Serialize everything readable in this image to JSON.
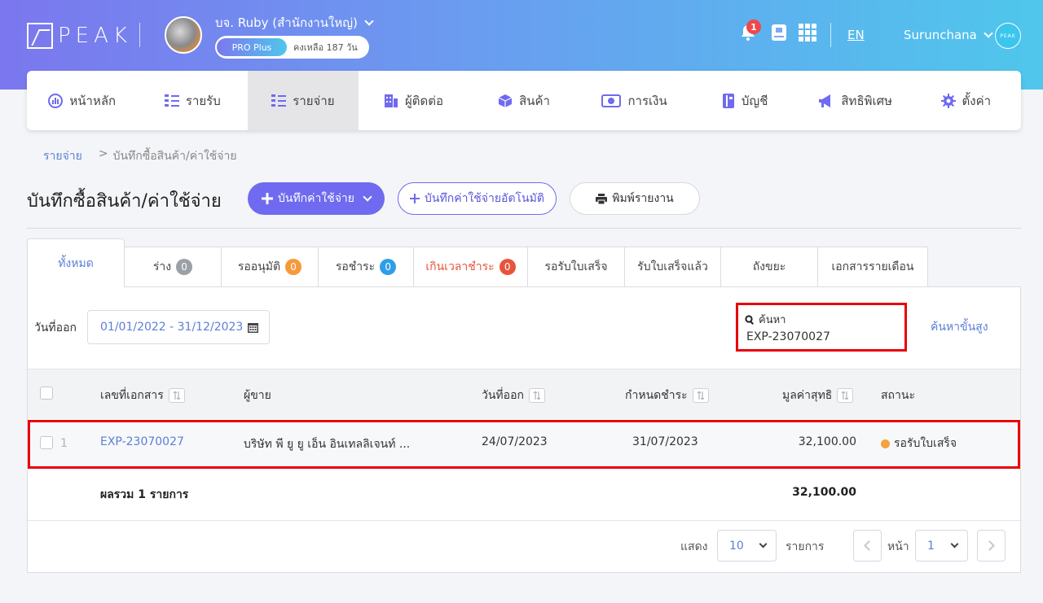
{
  "header": {
    "logo_text": "PEAK",
    "company_name": "บจ. Ruby (สำนักงานใหญ่)",
    "plan_badge": "PRO Plus",
    "plan_remaining": "คงเหลือ 187 วัน",
    "notification_count": "1",
    "language": "EN",
    "user_name": "Surunchana",
    "user_avatar_text": "PEAK"
  },
  "nav": {
    "items": [
      {
        "label": "หน้าหลัก",
        "icon": "dashboard-icon"
      },
      {
        "label": "รายรับ",
        "icon": "income-icon"
      },
      {
        "label": "รายจ่าย",
        "icon": "expense-icon",
        "active": true
      },
      {
        "label": "ผู้ติดต่อ",
        "icon": "contacts-icon"
      },
      {
        "label": "สินค้า",
        "icon": "box-icon"
      },
      {
        "label": "การเงิน",
        "icon": "money-icon"
      },
      {
        "label": "บัญชี",
        "icon": "ledger-icon"
      },
      {
        "label": "สิทธิพิเศษ",
        "icon": "megaphone-icon"
      },
      {
        "label": "ตั้งค่า",
        "icon": "gear-icon"
      }
    ]
  },
  "breadcrumb": {
    "root": "รายจ่าย",
    "separator": ">",
    "current": "บันทึกซื้อสินค้า/ค่าใช้จ่าย"
  },
  "page": {
    "title": "บันทึกซื้อสินค้า/ค่าใช้จ่าย",
    "btn_add": "บันทึกค่าใช้จ่าย",
    "btn_auto": "บันทึกค่าใช้จ่ายอัตโนมัติ",
    "btn_print": "พิมพ์รายงาน"
  },
  "tabs": [
    {
      "label": "ทั้งหมด",
      "count": ""
    },
    {
      "label": "ร่าง",
      "count": "0",
      "color": "#9aa0a6"
    },
    {
      "label": "รออนุมัติ",
      "count": "0",
      "color": "#f59a3a"
    },
    {
      "label": "รอชำระ",
      "count": "0",
      "color": "#2f9ee8"
    },
    {
      "label": "เกินเวลาชำระ",
      "count": "0",
      "color": "#e8543b"
    },
    {
      "label": "รอรับใบเสร็จ",
      "count": ""
    },
    {
      "label": "รับใบเสร็จแล้ว",
      "count": ""
    },
    {
      "label": "ถังขยะ",
      "count": ""
    },
    {
      "label": "เอกสารรายเดือน",
      "count": ""
    }
  ],
  "filters": {
    "date_label": "วันที่ออก",
    "date_range": "01/01/2022 - 31/12/2023",
    "search_label": "ค้นหา",
    "search_value": "EXP-23070027",
    "advanced_search": "ค้นหาขั้นสูง"
  },
  "table": {
    "columns": [
      "เลขที่เอกสาร",
      "ผู้ขาย",
      "วันที่ออก",
      "กำหนดชำระ",
      "มูลค่าสุทธิ",
      "สถานะ"
    ],
    "rows": [
      {
        "index": "1",
        "doc_no": "EXP-23070027",
        "vendor": "บริษัท พี ยู ยู เอ็น อินเทลลิเจนท์ ...",
        "issue_date": "24/07/2023",
        "due_date": "31/07/2023",
        "net_amount": "32,100.00",
        "status": "รอรับใบเสร็จ",
        "status_color": "#f5a23d"
      }
    ],
    "total_label": "ผลรวม 1 รายการ",
    "total_value": "32,100.00"
  },
  "pagination": {
    "show_label": "แสดง",
    "page_size": "10",
    "items_label": "รายการ",
    "page_label": "หน้า",
    "page_number": "1"
  },
  "colors": {
    "accent": "#6f6af0",
    "link": "#5b7fd6",
    "highlight_border": "#e8000b"
  }
}
